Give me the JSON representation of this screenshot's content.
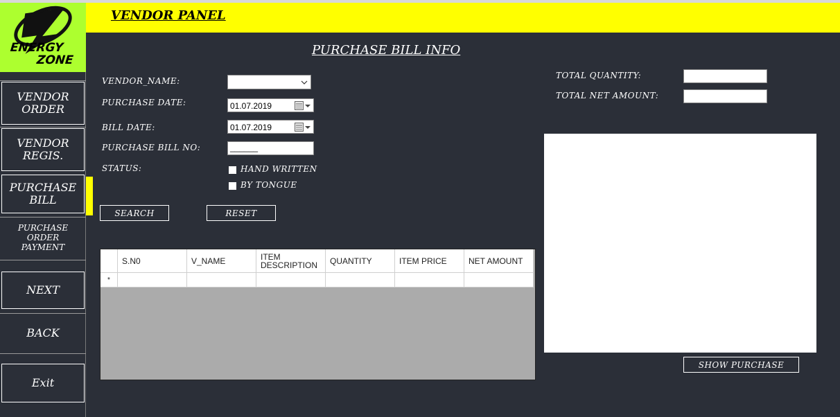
{
  "app": {
    "panel_title": "VENDOR PANEL",
    "page_title": "PURCHASE BILL INFO"
  },
  "logo": {
    "line1": "ENERGY",
    "line2": "ZONE"
  },
  "sidebar": {
    "items": [
      {
        "label": "VENDOR ORDER"
      },
      {
        "label": "VENDOR REGIS."
      },
      {
        "label": "PURCHASE BILL"
      },
      {
        "label": "PURCHASE ORDER PAYMENT"
      },
      {
        "label": "NEXT"
      },
      {
        "label": "BACK"
      },
      {
        "label": "Exit"
      }
    ]
  },
  "form": {
    "vendor_name_label": "VENDOR_NAME:",
    "vendor_name_value": "",
    "purchase_date_label": "PURCHASE DATE:",
    "purchase_date_value": "01.07.2019",
    "bill_date_label": "BILL DATE:",
    "bill_date_value": "01.07.2019",
    "bill_no_label": "PURCHASE BILL NO:",
    "bill_no_value": "______",
    "status_label": "STATUS:",
    "status_options": [
      "HAND WRITTEN",
      "BY TONGUE"
    ],
    "search_label": "SEARCH",
    "reset_label": "RESET"
  },
  "summary": {
    "total_quantity_label": "TOTAL QUANTITY:",
    "total_quantity_value": "",
    "total_net_label": "TOTAL NET AMOUNT:",
    "total_net_value": "",
    "show_purchase_label": "SHOW PURCHASE"
  },
  "grid": {
    "columns": [
      "S.N0",
      "V_NAME",
      "ITEM DESCRIPTION",
      "QUANTITY",
      "ITEM PRICE",
      "NET AMOUNT"
    ],
    "new_row_marker": "*"
  },
  "colors": {
    "accent": "#ffff00",
    "logo_bg": "#adff2f",
    "background": "#2b2f38"
  }
}
